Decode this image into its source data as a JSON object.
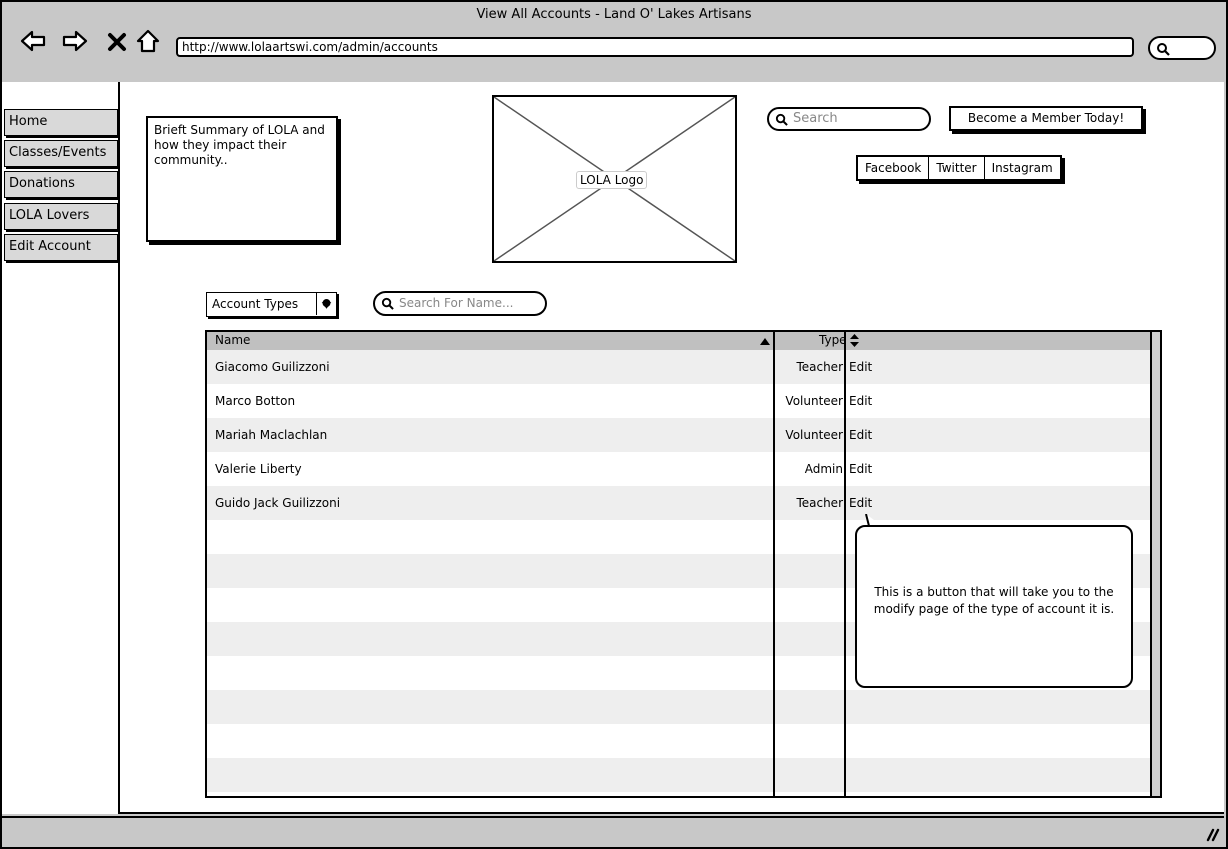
{
  "browser": {
    "title": "View All Accounts - Land O' Lakes Artisans",
    "url": "http://www.lolaartswi.com/admin/accounts",
    "icons": [
      "back-arrow-icon",
      "forward-arrow-icon",
      "stop-icon",
      "home-icon",
      "search-icon",
      "resize-grip-icon"
    ]
  },
  "sidebar": {
    "items": [
      {
        "label": "Home"
      },
      {
        "label": "Classes/Events"
      },
      {
        "label": "Donations"
      },
      {
        "label": "LOLA Lovers"
      },
      {
        "label": "Edit Account"
      }
    ]
  },
  "header": {
    "summary": "Brieft Summary of LOLA and how they impact their community..",
    "logo_label": "LOLA Logo",
    "search_placeholder": "Search",
    "member_button": "Become a Member Today!",
    "social": [
      "Facebook",
      "Twitter",
      "Instagram"
    ]
  },
  "filters": {
    "account_types_label": "Account Types",
    "name_search_placeholder": "Search For Name..."
  },
  "table": {
    "columns": {
      "name": "Name",
      "type": "Type"
    },
    "rows": [
      {
        "name": "Giacomo Guilizzoni",
        "type": "Teacher",
        "action": "Edit"
      },
      {
        "name": "Marco Botton",
        "type": "Volunteer",
        "action": "Edit"
      },
      {
        "name": "Mariah Maclachlan",
        "type": "Volunteer",
        "action": "Edit"
      },
      {
        "name": "Valerie Liberty",
        "type": "Admin",
        "action": "Edit"
      },
      {
        "name": "Guido Jack Guilizzoni",
        "type": "Teacher",
        "action": "Edit"
      }
    ]
  },
  "callout": {
    "text": "This is a button that will take you to the modify page of the type of account it is."
  }
}
